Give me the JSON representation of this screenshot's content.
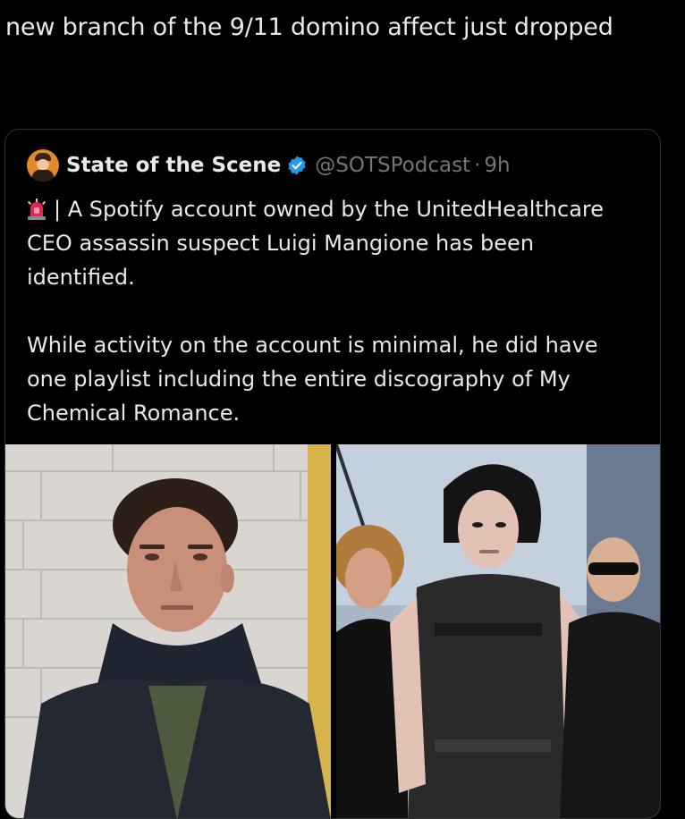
{
  "post": {
    "text": "new branch of the 9/11 domino affect just dropped"
  },
  "quote": {
    "author_name": "State of the Scene",
    "handle": "@SOTSPodcast",
    "separator": "·",
    "time": "9h",
    "verified_icon": "verified-badge-icon",
    "avatar_icon": "avatar-icon",
    "paragraph1": "| A Spotify account owned by the UnitedHealthcare CEO assassin suspect Luigi Mangione has been identified.",
    "paragraph2": "While activity on the account is minimal, he did have one playlist including the entire discography of My Chemical Romance.",
    "siren_icon": "siren-emoji-icon"
  },
  "media": {
    "photos": [
      {
        "name": "photo-left"
      },
      {
        "name": "photo-right"
      }
    ]
  },
  "colors": {
    "background": "#000000",
    "text": "#e7e9ea",
    "muted": "#71767b",
    "border": "#2f3336",
    "verified": "#1d9bf0"
  }
}
